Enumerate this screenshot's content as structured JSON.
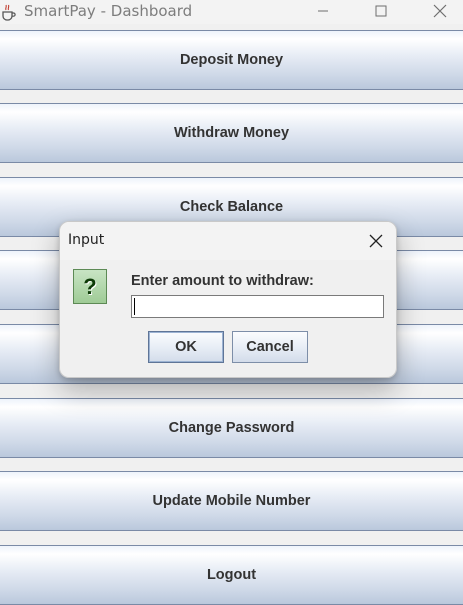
{
  "window": {
    "title": "SmartPay - Dashboard",
    "icons": {
      "app": "java-cup-icon",
      "minimize": "minimize-icon",
      "maximize": "maximize-icon",
      "close": "close-icon"
    }
  },
  "menu": {
    "buttons": [
      "Deposit Money",
      "Withdraw Money",
      "Check Balance",
      "",
      "",
      "Change Password",
      "Update Mobile Number",
      "Logout"
    ]
  },
  "dialog": {
    "title": "Input",
    "icon": "question-icon",
    "icon_glyph": "?",
    "prompt": "Enter amount to withdraw:",
    "input_value": "",
    "ok_label": "OK",
    "cancel_label": "Cancel"
  },
  "colors": {
    "button_border": "#7a8aa6",
    "button_gradient_top": "#ffffff",
    "button_gradient_bottom": "#bac8dc",
    "question_icon_green": "#9fcb96"
  }
}
